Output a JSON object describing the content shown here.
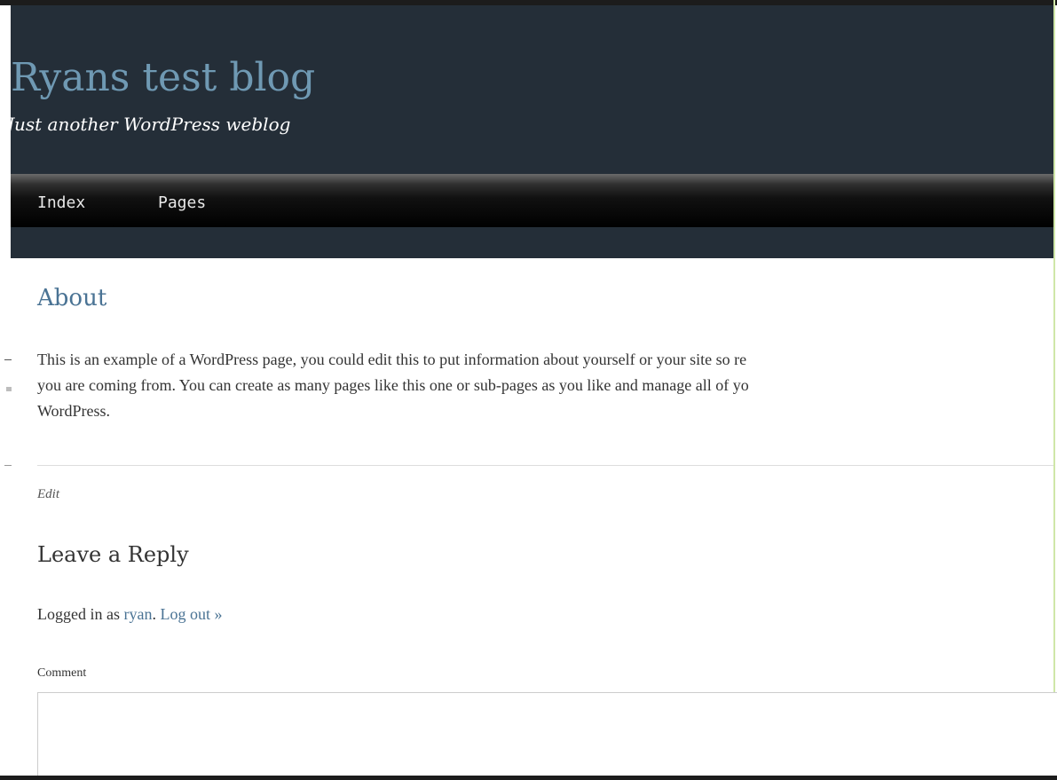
{
  "header": {
    "site_title": "Ryans test blog",
    "tagline": "Just another WordPress weblog"
  },
  "nav": {
    "items": [
      {
        "label": "Index"
      },
      {
        "label": "Pages"
      }
    ]
  },
  "page": {
    "title": "About",
    "body_lines": [
      "This is an example of a WordPress page, you could edit this to put information about yourself or your site so re",
      "you are coming from. You can create as many pages like this one or sub-pages as you like and manage all of yo",
      "WordPress."
    ],
    "edit_label": "Edit"
  },
  "reply": {
    "heading": "Leave a Reply",
    "logged_in_prefix": "Logged in as ",
    "username": "ryan",
    "separator": ". ",
    "logout_label": "Log out »",
    "comment_label": "Comment",
    "comment_value": ""
  },
  "colors": {
    "header_bg": "#242e38",
    "title_color": "#6f99b3",
    "link_color": "#4a7394",
    "nav_text": "#e8e8e8"
  }
}
